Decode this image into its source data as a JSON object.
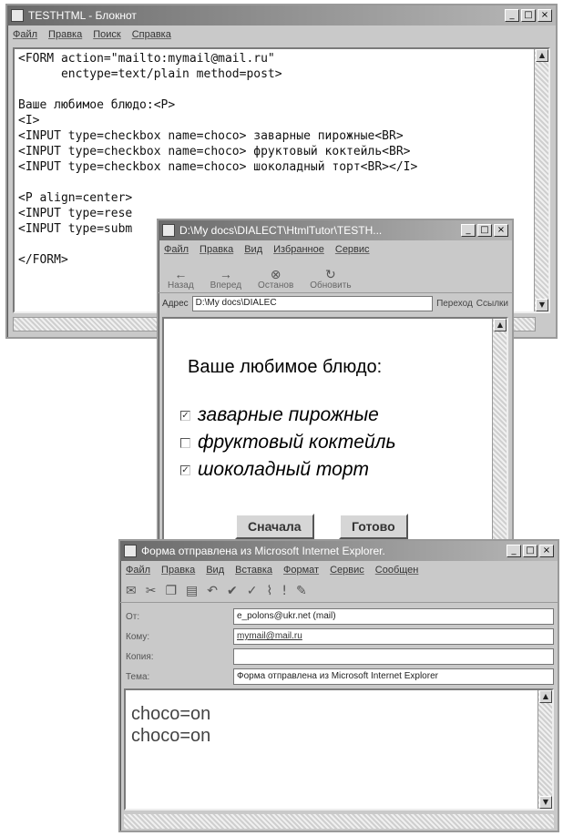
{
  "notepad": {
    "title": "TESTHTML - Блокнот",
    "menu": [
      "Файл",
      "Правка",
      "Поиск",
      "Справка"
    ],
    "code": "<FORM action=\"mailto:mymail@mail.ru\"\n      enctype=text/plain method=post>\n\nВаше любимое блюдо:<P>\n<I>\n<INPUT type=checkbox name=choco> заварные пирожные<BR>\n<INPUT type=checkbox name=choco> фруктовый коктейль<BR>\n<INPUT type=checkbox name=choco> шоколадный торт<BR></I>\n\n<P align=center>\n<INPUT type=rese\n<INPUT type=subm\n\n</FORM>"
  },
  "ie": {
    "title": "D:\\My docs\\DIALECT\\HtmlTutor\\TESTH...",
    "menu": [
      "Файл",
      "Правка",
      "Вид",
      "Избранное",
      "Сервис"
    ],
    "toolbar": [
      {
        "label": "Назад",
        "icon": "back-arrow-icon"
      },
      {
        "label": "Вперед",
        "icon": "forward-arrow-icon"
      },
      {
        "label": "Останов",
        "icon": "stop-icon"
      },
      {
        "label": "Обновить",
        "icon": "refresh-icon"
      }
    ],
    "address_label": "Адрес",
    "address_value": "D:\\My docs\\DIALEC",
    "go_label": "Переход",
    "links_label": "Ссылки",
    "form_heading": "Ваше любимое блюдо:",
    "options": [
      {
        "label": "заварные пирожные",
        "checked": true
      },
      {
        "label": "фруктовый коктейль",
        "checked": false
      },
      {
        "label": "шоколадный торт",
        "checked": true
      }
    ],
    "reset_label": "Сначала",
    "submit_label": "Готово"
  },
  "oe": {
    "title": "Форма отправлена из Microsoft Internet Explorer.",
    "menu": [
      "Файл",
      "Правка",
      "Вид",
      "Вставка",
      "Формат",
      "Сервис",
      "Сообщен"
    ],
    "from_label": "От:",
    "from_value": "e_polons@ukr.net   (mail)",
    "to_label": "Кому:",
    "to_value": "mymail@mail.ru",
    "cc_label": "Копия:",
    "cc_value": "",
    "subject_label": "Тема:",
    "subject_value": "Форма отправлена из Microsoft Internet Explorer",
    "body_lines": [
      "choco=on",
      "choco=on"
    ]
  }
}
